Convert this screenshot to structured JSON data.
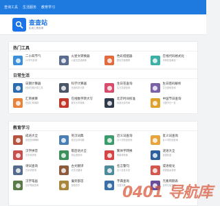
{
  "topnav": [
    "查询工具",
    "生活服务",
    "教育学习"
  ],
  "logo": {
    "title": "查查站",
    "subtitle": "实用工具查询"
  },
  "sections": [
    {
      "title": "热门工具",
      "items": [
        {
          "name": "二十四节气",
          "desc": "24节气查询",
          "color": "#3a8fd8"
        },
        {
          "name": "火星文转换器",
          "desc": "火星文在线转换",
          "color": "#5a6d8c"
        },
        {
          "name": "色彩搭配器",
          "desc": "配色方案推荐",
          "color": "#e26a3d"
        },
        {
          "name": "在线代码格式化",
          "desc": "代码在线美化",
          "color": "#3bb0a5"
        }
      ]
    },
    {
      "title": "日常生活",
      "items": [
        {
          "name": "日期计算器",
          "desc": "在线日期计算工具",
          "color": "#2b6cb0"
        },
        {
          "name": "科学计算器",
          "desc": "在线科学计算",
          "color": "#4a5568"
        },
        {
          "name": "生日花查询",
          "desc": "生日花语查询",
          "color": "#d94b6b"
        },
        {
          "name": "生日密码解析",
          "desc": "生日密码查询",
          "color": "#7b61a8"
        },
        {
          "name": "汇率换算",
          "desc": "在线汇率换算",
          "color": "#e8823a"
        },
        {
          "name": "在线数字转大写",
          "desc": "数字大写转换",
          "color": "#c0392b"
        },
        {
          "name": "北京时间校准",
          "desc": "标准北京时间",
          "color": "#2f3a4a"
        },
        {
          "name": "中国节日查询",
          "desc": "中国节日一览",
          "color": "#e0a12b"
        }
      ]
    },
    {
      "title": "教育学习",
      "items": [
        {
          "name": "成语大全",
          "desc": "成语查询解释",
          "color": "#b5533c"
        },
        {
          "name": "英汉词典",
          "desc": "英汉互译词典",
          "color": "#4a7fb5"
        },
        {
          "name": "近义词查询",
          "desc": "近义词在线查询",
          "color": "#3d9c6b"
        },
        {
          "name": "反义词查询",
          "desc": "反义词在线查询",
          "color": "#e8a33a"
        },
        {
          "name": "汉字拼音",
          "desc": "汉字转拼音",
          "color": "#c94f4f"
        },
        {
          "name": "歇后语大全",
          "desc": "歇后语查询",
          "color": "#3a8f5a"
        },
        {
          "name": "繁体字转换",
          "desc": "简繁体转换",
          "color": "#d64545"
        },
        {
          "name": "谜语大全",
          "desc": "谜语猜谜",
          "color": "#2c5f9e"
        },
        {
          "name": "诗词查询",
          "desc": "古诗词查询",
          "color": "#556b8d"
        },
        {
          "name": "古文翻译",
          "desc": "文言文翻译",
          "color": "#8c5a3c"
        },
        {
          "name": "名言警句",
          "desc": "名人名言大全",
          "color": "#4b8b9b"
        },
        {
          "name": "成语接龙",
          "desc": "成语接龙游戏",
          "color": "#d4574a"
        },
        {
          "name": "汉字笔画",
          "desc": "汉字笔画查询",
          "color": "#5b7a4a"
        },
        {
          "name": "偏旁部首",
          "desc": "部首查字",
          "color": "#a8863c"
        },
        {
          "name": "字典查询",
          "desc": "汉语字典",
          "color": "#3b6fa8"
        },
        {
          "name": "元素周期表",
          "desc": "化学元素查询",
          "color": "#6a4c9c"
        }
      ]
    }
  ],
  "watermark": "0401 导航库"
}
